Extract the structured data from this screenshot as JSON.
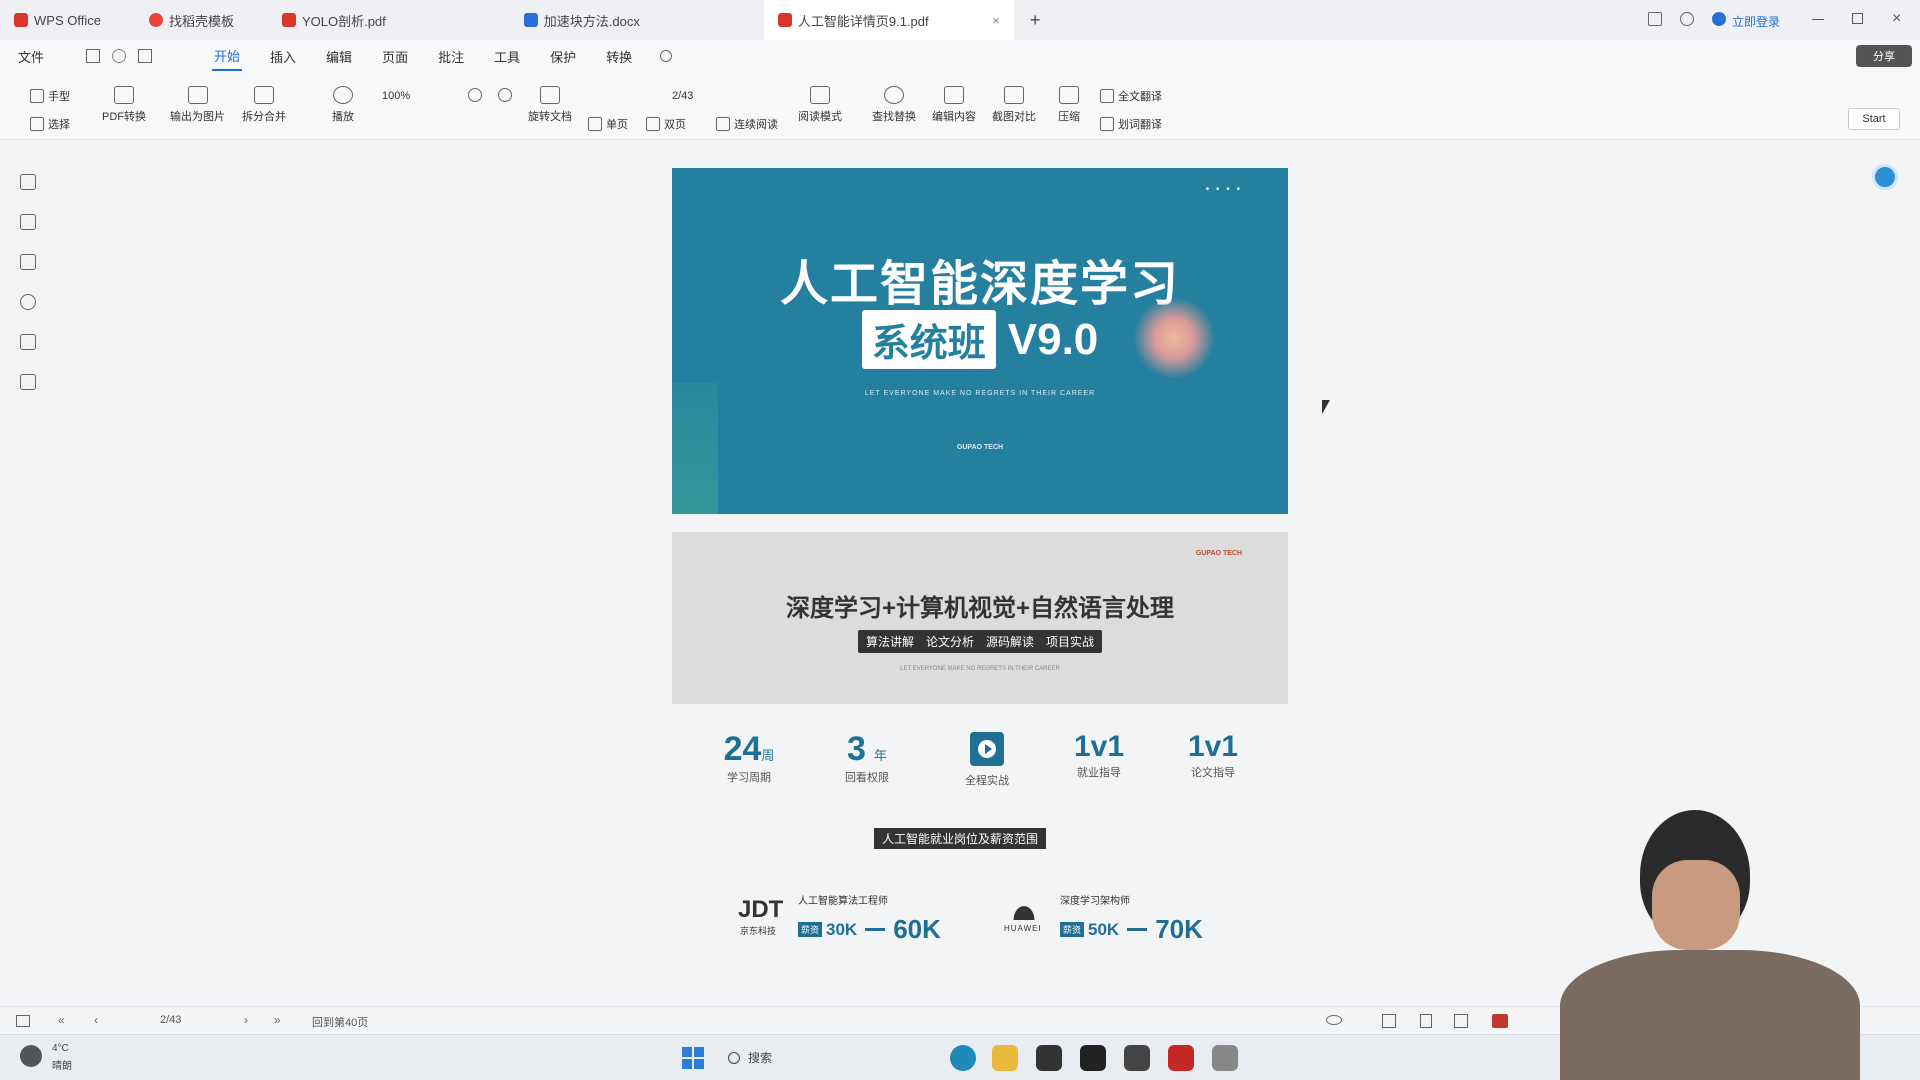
{
  "tabs": [
    {
      "label": "WPS Office",
      "color": "#d9372b"
    },
    {
      "label": "找稻壳模板",
      "color": "#e8453c"
    },
    {
      "label": "YOLO剖析.pdf",
      "color": "#d9372b"
    },
    {
      "label": "加速块方法.docx",
      "color": "#2b6fd6"
    },
    {
      "label": "人工智能详情页9.1.pdf",
      "color": "#d9372b"
    }
  ],
  "window": {
    "login": "立即登录"
  },
  "menu": {
    "file": "文件",
    "items": [
      "开始",
      "插入",
      "编辑",
      "页面",
      "批注",
      "工具",
      "保护",
      "转换"
    ],
    "share": "分享"
  },
  "ribbon": {
    "hand": "手型",
    "select": "选择",
    "pdf_convert": "PDF转换",
    "export_image": "输出为图片",
    "split_merge": "拆分合并",
    "play": "播放",
    "zoom": "100%",
    "rotate": "旋转文档",
    "page_num": "2/43",
    "single": "单页",
    "double": "双页",
    "continuous": "连续阅读",
    "read_mode": "阅读模式",
    "find_replace": "查找替换",
    "edit_content": "编辑内容",
    "screenshot_compare": "截图对比",
    "compress": "压缩",
    "full_translate": "全文翻译",
    "word_translate": "划词翻译",
    "start": "Start"
  },
  "page1": {
    "title": "人工智能深度学习",
    "badge": "系统班",
    "version": "V9.0",
    "tagline": "LET EVERYONE MAKE NO REGRETS IN THEIR CAREER",
    "brand": "GUPAO TECH"
  },
  "page2": {
    "brand": "GUPAO TECH",
    "title": "深度学习+计算机视觉+自然语言处理",
    "tags": [
      "算法讲解",
      "论文分析",
      "源码解读",
      "项目实战"
    ],
    "tagline": "LET EVERYONE MAKE NO REGRETS IN THEIR CAREER"
  },
  "stats": [
    {
      "num": "24",
      "unit": "周",
      "label": "学习周期"
    },
    {
      "num": "3",
      "unit": "年",
      "label": "回看权限"
    },
    {
      "num": "",
      "unit": "",
      "label": "全程实战"
    },
    {
      "num": "1v1",
      "unit": "",
      "label": "就业指导"
    },
    {
      "num": "1v1",
      "unit": "",
      "label": "论文指导"
    }
  ],
  "jobs_header": "人工智能就业岗位及薪资范围",
  "jobs": [
    {
      "company": "JDT",
      "company_sub": "京东科技",
      "role": "人工智能算法工程师",
      "tag": "薪资",
      "low": "30K",
      "high": "60K"
    },
    {
      "company": "",
      "company_sub": "HUAWEI",
      "role": "深度学习架构师",
      "tag": "薪资",
      "low": "50K",
      "high": "70K"
    }
  ],
  "status": {
    "page": "2/43",
    "goto": "回到第40页"
  },
  "taskbar": {
    "weather_temp": "4°C",
    "weather_desc": "晴朗",
    "search": "搜索"
  }
}
